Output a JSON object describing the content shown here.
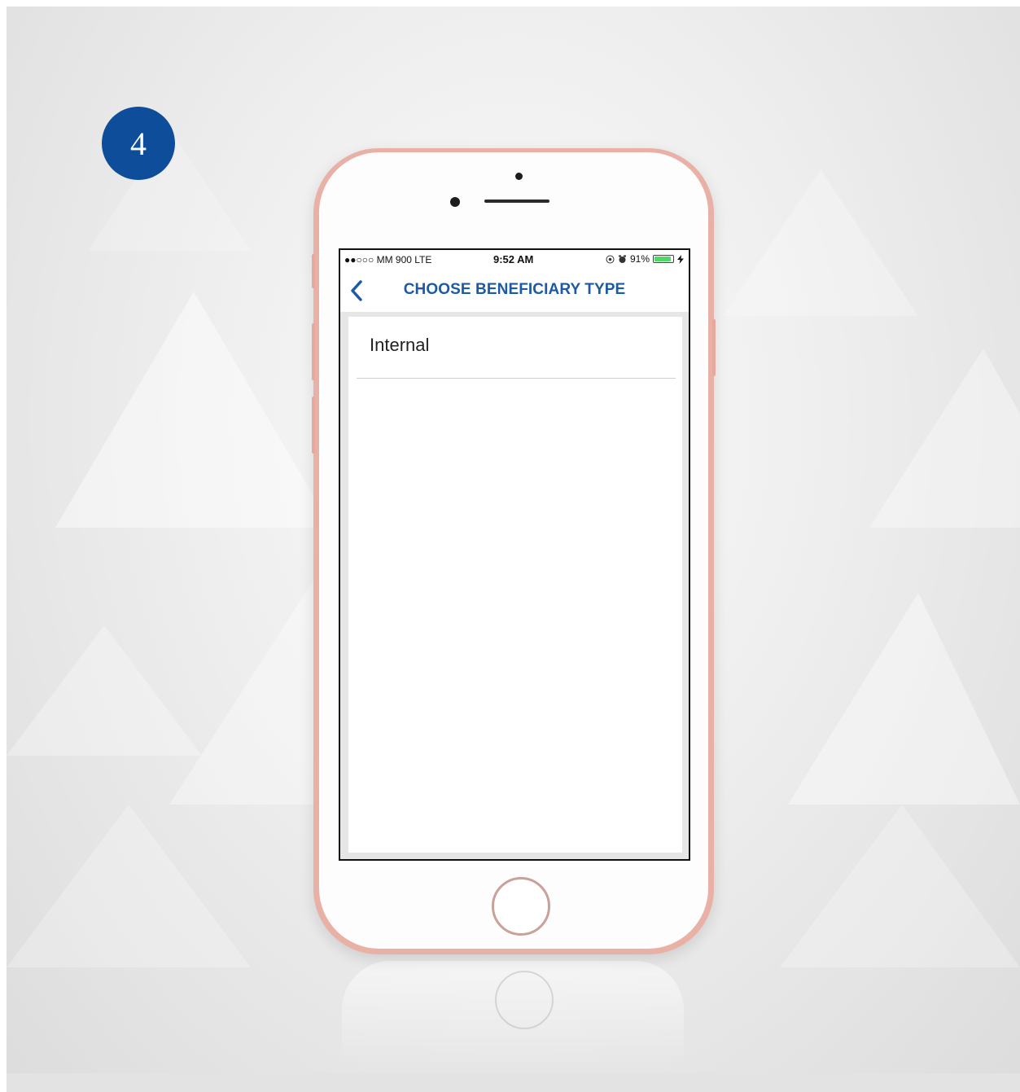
{
  "step": {
    "number": "4"
  },
  "status_bar": {
    "carrier": "●●○○○ MM 900  LTE",
    "time": "9:52 AM",
    "battery": "91%",
    "battery_level": 0.91
  },
  "nav": {
    "title": "CHOOSE BENEFICIARY TYPE"
  },
  "list": {
    "items": [
      {
        "label": "Internal"
      }
    ]
  },
  "colors": {
    "accent": "#1c5aa5",
    "badge": "#0d4d9a",
    "phone_frame": "#e9b0a6",
    "battery": "#4cd964"
  }
}
